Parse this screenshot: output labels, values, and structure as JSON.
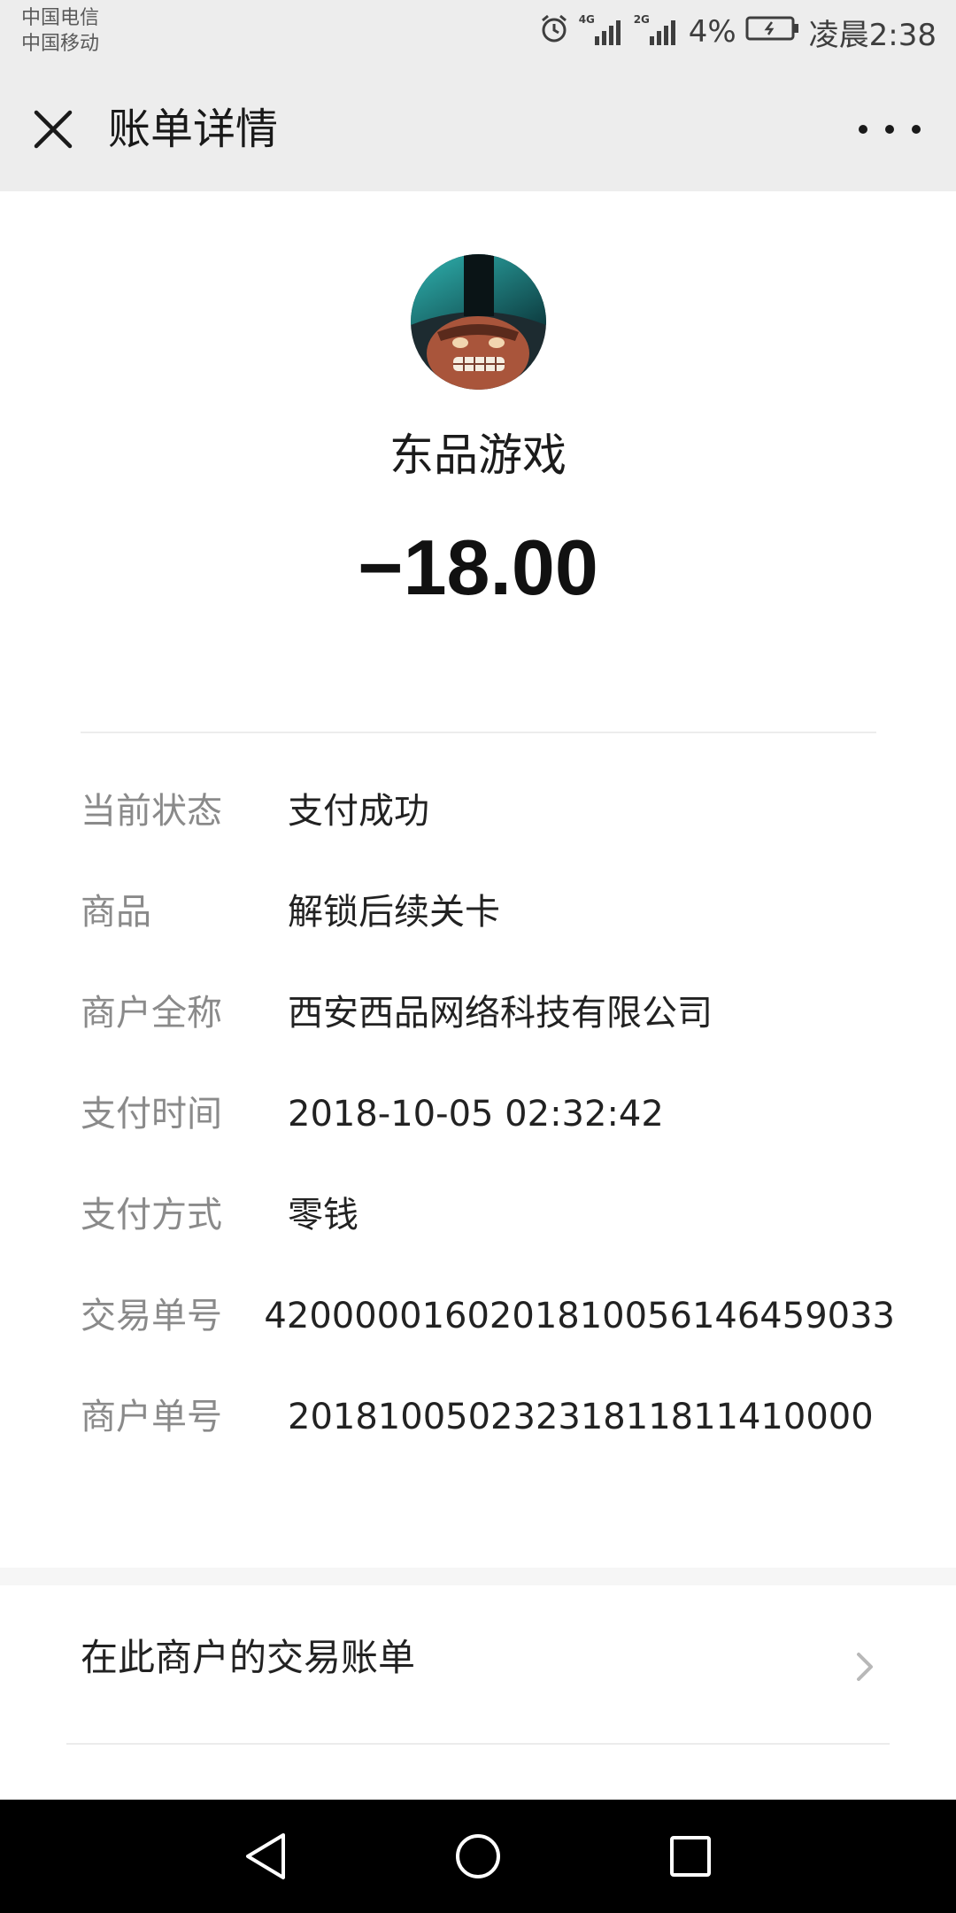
{
  "status_bar": {
    "carrier_1": "中国电信",
    "carrier_2": "中国移动",
    "network_1": "4G",
    "network_2": "2G",
    "battery": "4%",
    "time": "凌晨2:38",
    "icons": [
      "alarm-icon",
      "signal-icon",
      "battery-charging-icon"
    ]
  },
  "header": {
    "title": "账单详情",
    "close_icon": "close-icon",
    "more_icon": "more-icon"
  },
  "merchant": {
    "name": "东品游戏",
    "amount": "−18.00"
  },
  "details": [
    {
      "label": "当前状态",
      "value": "支付成功"
    },
    {
      "label": "商品",
      "value": "解锁后续关卡"
    },
    {
      "label": "商户全称",
      "value": "西安西品网络科技有限公司"
    },
    {
      "label": "支付时间",
      "value": "2018-10-05 02:32:42"
    },
    {
      "label": "支付方式",
      "value": "零钱"
    },
    {
      "label": "交易单号",
      "value": "4200000160201810056146459033"
    },
    {
      "label": "商户单号",
      "value": "20181005023231811811410000"
    }
  ],
  "links": {
    "merchant_bills": "在此商户的交易账单"
  },
  "nav_bar": {
    "icons": [
      "back-icon",
      "home-icon",
      "recents-icon"
    ]
  },
  "colors": {
    "header_bg": "#ededed",
    "label_gray": "#8a8a8a",
    "text_dark": "#222222"
  }
}
